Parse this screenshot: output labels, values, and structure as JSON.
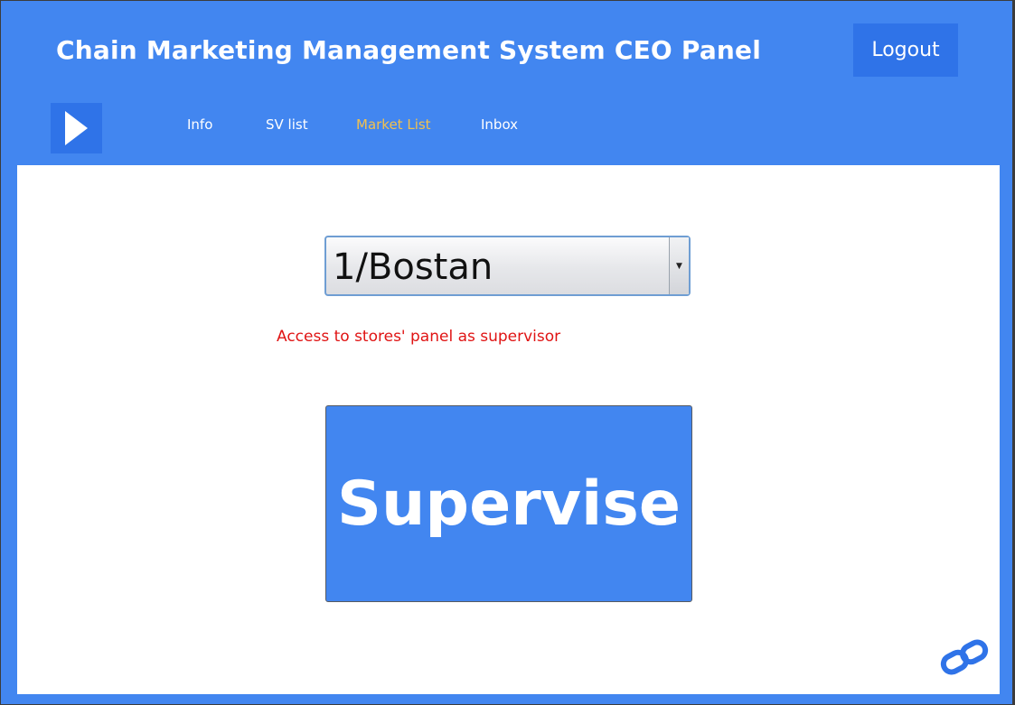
{
  "header": {
    "title": "Chain Marketing Management System CEO Panel",
    "logout_label": "Logout"
  },
  "nav": {
    "toggle_icon": "play-arrow-icon",
    "items": [
      {
        "label": "Info",
        "active": false
      },
      {
        "label": "SV list",
        "active": false
      },
      {
        "label": "Market List",
        "active": true
      },
      {
        "label": "Inbox",
        "active": false
      }
    ]
  },
  "main": {
    "market_select": {
      "selected": "1/Bostan"
    },
    "hint_text": "Access to stores' panel as supervisor",
    "supervise_label": "Supervise",
    "footer_icon": "link-chain-icon"
  },
  "colors": {
    "brand_blue": "#4286f0",
    "dark_blue": "#2f73e8",
    "active_nav": "#f2c14e",
    "hint_red": "#e01414"
  }
}
